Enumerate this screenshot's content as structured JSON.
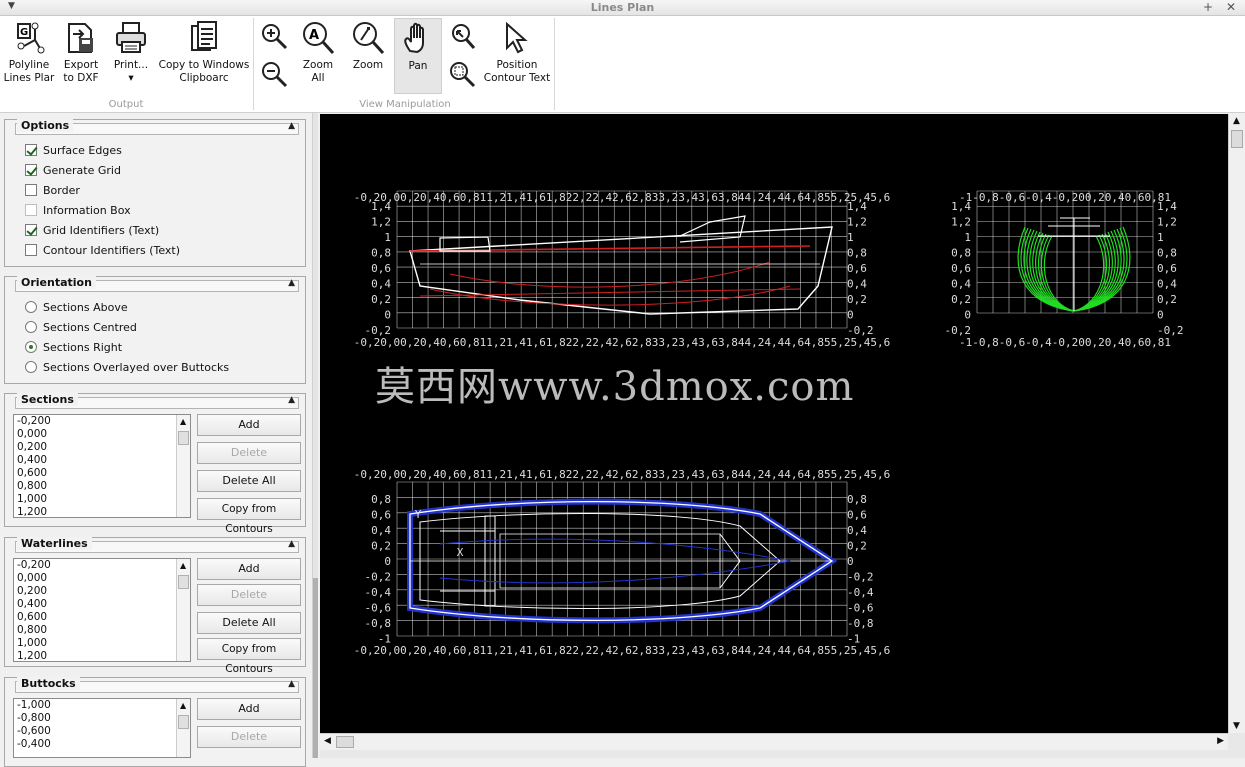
{
  "window": {
    "title": "Lines Plan",
    "menu_icon": "chevron-down-icon",
    "pin_icon": "pin-icon",
    "close_icon": "close-icon"
  },
  "ribbon": {
    "groups": [
      {
        "name": "Output",
        "buttons": [
          {
            "line1": "Polyline",
            "line2": "Lines Plar",
            "icon": "polyline-icon"
          },
          {
            "line1": "Export",
            "line2": "to DXF",
            "icon": "export-dxf-icon"
          },
          {
            "line1": "Print...",
            "line2": "▾",
            "icon": "printer-icon"
          },
          {
            "line1": "Copy to Windows",
            "line2": "Clipboarc",
            "icon": "clipboard-icon"
          }
        ]
      },
      {
        "name": "View Manipulation",
        "buttons": [
          {
            "line1": "",
            "line2": "",
            "icon": "zoom-in-icon"
          },
          {
            "line1": "",
            "line2": "",
            "icon": "zoom-out-icon"
          },
          {
            "line1": "Zoom",
            "line2": "All",
            "icon": "zoom-all-icon"
          },
          {
            "line1": "Zoom",
            "line2": "",
            "icon": "zoom-icon"
          },
          {
            "line1": "Pan",
            "line2": "",
            "icon": "pan-hand-icon"
          },
          {
            "line1": "",
            "line2": "",
            "icon": "zoom-previous-icon"
          },
          {
            "line1": "",
            "line2": "",
            "icon": "zoom-window-icon"
          },
          {
            "line1": "Position",
            "line2": "Contour Text",
            "icon": "cursor-arrow-icon"
          }
        ]
      }
    ]
  },
  "options": {
    "title": "Options",
    "items": [
      {
        "label": "Surface Edges",
        "checked": true
      },
      {
        "label": "Generate Grid",
        "checked": true
      },
      {
        "label": "Border",
        "checked": false
      },
      {
        "label": "Information Box",
        "checked": false
      },
      {
        "label": "Grid Identifiers (Text)",
        "checked": true
      },
      {
        "label": "Contour Identifiers (Text)",
        "checked": false
      }
    ]
  },
  "orientation": {
    "title": "Orientation",
    "items": [
      {
        "label": "Sections Above",
        "selected": false
      },
      {
        "label": "Sections Centred",
        "selected": false
      },
      {
        "label": "Sections Right",
        "selected": true
      },
      {
        "label": "Sections Overlayed over Buttocks",
        "selected": false
      }
    ]
  },
  "sections": {
    "title": "Sections",
    "values": [
      "-0,200",
      "0,000",
      "0,200",
      "0,400",
      "0,600",
      "0,800",
      "1,000",
      "1,200"
    ],
    "buttons": {
      "add": "Add",
      "delete": "Delete",
      "delete_all": "Delete All",
      "copy": "Copy from Contours"
    }
  },
  "waterlines": {
    "title": "Waterlines",
    "values": [
      "-0,200",
      "0,000",
      "0,200",
      "0,400",
      "0,600",
      "0,800",
      "1,000",
      "1,200"
    ],
    "buttons": {
      "add": "Add",
      "delete": "Delete",
      "delete_all": "Delete All",
      "copy": "Copy from Contours"
    }
  },
  "buttocks": {
    "title": "Buttocks",
    "values": [
      "-1,000",
      "-0,800",
      "-0,600",
      "-0,400"
    ],
    "buttons": {
      "add": "Add",
      "delete": "Delete"
    }
  },
  "canvas": {
    "watermark": "莫西网www.3dmox.com",
    "profile_y_labels": [
      "1,4",
      "1,2",
      "1",
      "0,8",
      "0,6",
      "0,4",
      "0,2",
      "0",
      "-0,2"
    ],
    "plan_y_labels": [
      "0,8",
      "0,6",
      "0,4",
      "0,2",
      "0",
      "-0,2",
      "-0,4",
      "-0,6",
      "-0,8",
      "-1"
    ],
    "x_labels_text": "-0,20,00,20,40,60,811,21,41,61,822,22,42,62,833,23,43,63,844,24,44,64,855,25,45,6",
    "body_x_labels_text": "-1-0,8-0,6-0,4-0,200,20,40,60,81",
    "colors": {
      "grid": "#ffffff",
      "sheer": "#ffffff",
      "red": "#d02020",
      "blue": "#2233cc",
      "green": "#22dd22"
    }
  }
}
